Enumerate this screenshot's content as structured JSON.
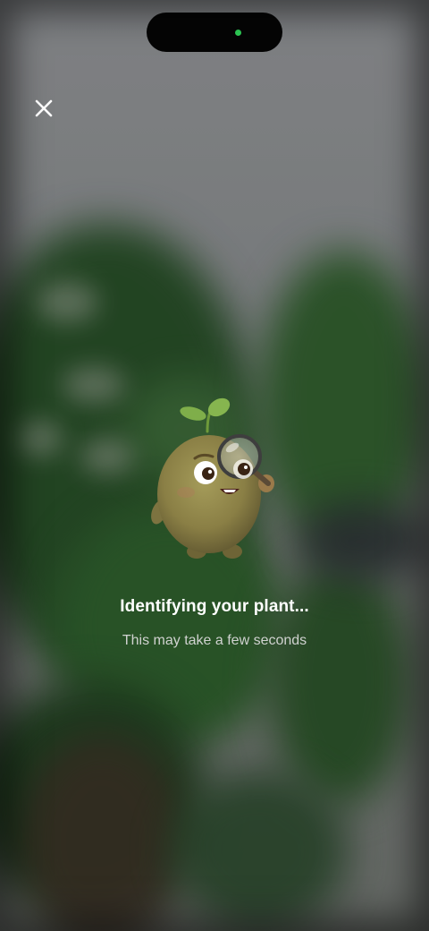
{
  "status_bar": {
    "camera_indicator_color": "#2fd158"
  },
  "header": {
    "close_icon": "close-icon"
  },
  "mascot": {
    "name": "seed-mascot-with-magnifier",
    "colors": {
      "body": "#8f8a4a",
      "leaf": "#7fae4a"
    }
  },
  "status": {
    "title": "Identifying your plant...",
    "subtitle": "This may take a few seconds"
  }
}
